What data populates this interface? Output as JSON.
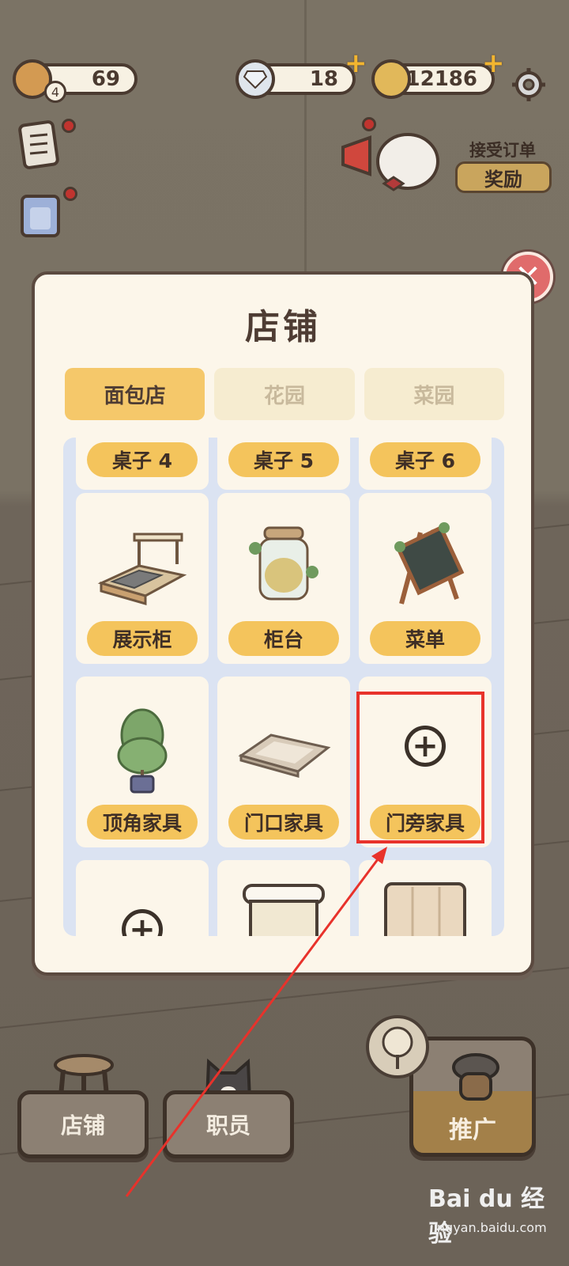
{
  "hud": {
    "bread_count": "69",
    "bread_level": "4",
    "diamonds": "18",
    "coins": "12186"
  },
  "order_widget": {
    "title": "接受订单",
    "button": "奖励"
  },
  "modal": {
    "title": "店铺",
    "tabs": [
      {
        "label": "面包店",
        "active": true
      },
      {
        "label": "花园",
        "active": false
      },
      {
        "label": "菜园",
        "active": false
      }
    ],
    "items": [
      {
        "label": "桌子 4"
      },
      {
        "label": "桌子 5"
      },
      {
        "label": "桌子 6"
      },
      {
        "label": "展示柜"
      },
      {
        "label": "柜台"
      },
      {
        "label": "菜单"
      },
      {
        "label": "顶角家具"
      },
      {
        "label": "门口家具"
      },
      {
        "label": "门旁家具"
      }
    ],
    "close_symbol": "✕",
    "plus_symbol": "+"
  },
  "bottom_nav": {
    "shop": "店铺",
    "staff": "职员",
    "promote": "推广"
  },
  "watermark": {
    "brand": "Bai du 经验",
    "url": "jingyan.baidu.com"
  },
  "colors": {
    "accent_yellow": "#f4c45c",
    "highlight_red": "#e8322b",
    "close_red": "#e06b6b"
  }
}
